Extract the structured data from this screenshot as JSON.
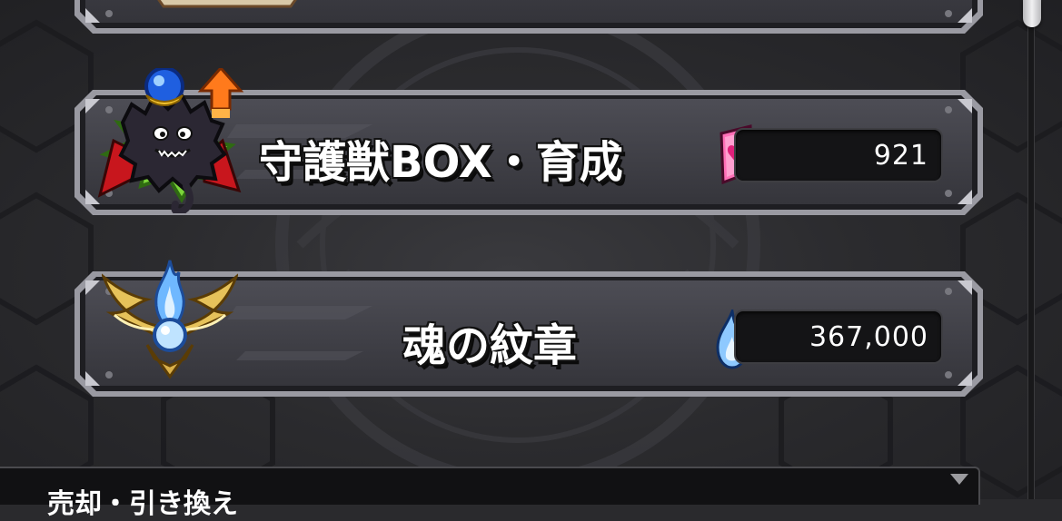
{
  "menu": {
    "items": [
      {
        "title": "",
        "value": "",
        "icon": "scroll-icon"
      },
      {
        "title": "守護獣BOX・育成",
        "value": "921",
        "icon": "sentinel-creature-icon",
        "currency_icon": "pink-gem-icon"
      },
      {
        "title": "魂の紋章",
        "value": "367,000",
        "icon": "winged-soul-crest-icon",
        "currency_icon": "blue-flame-icon"
      }
    ]
  },
  "bottom_panel": {
    "label": "売却・引き換え",
    "dropdown_icon": "triangle-down-icon"
  },
  "colors": {
    "plate_face": "#3d3d44",
    "plate_border": "#8f8f96",
    "accent_blue": "#6fb8ff",
    "accent_pink": "#ff5aa8"
  }
}
